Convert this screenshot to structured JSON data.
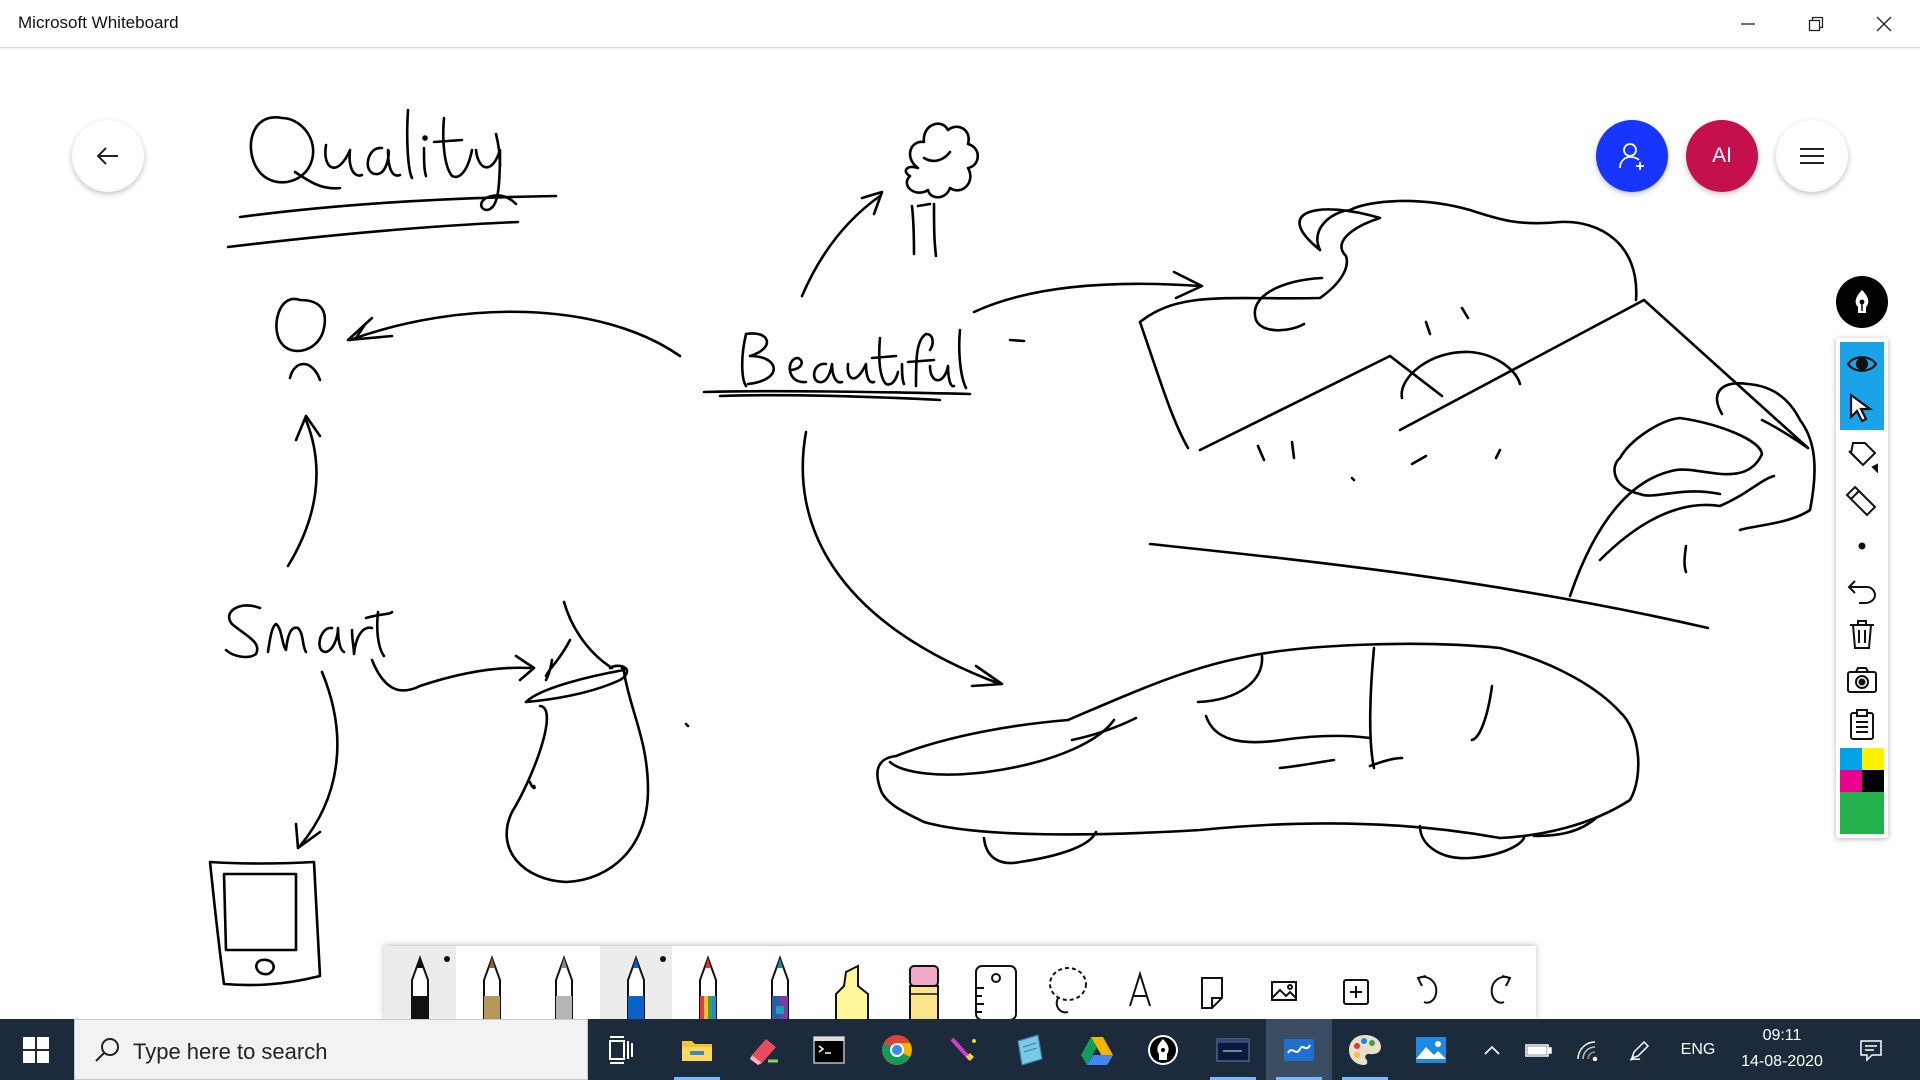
{
  "window": {
    "title": "Microsoft Whiteboard"
  },
  "header": {
    "avatar_initials": "AI"
  },
  "board": {
    "handwritten_words": [
      "Quality",
      "Beautiful",
      "Smart"
    ]
  },
  "right_toolbar": {
    "tools": [
      "eye-icon",
      "select-arrow-icon",
      "lasso-tag-icon",
      "eraser-icon",
      "dot-icon",
      "undo-icon",
      "delete-icon",
      "camera-icon",
      "clipboard-icon"
    ],
    "palette_colors": [
      "#00a2e8",
      "#fff200",
      "#e9008b",
      "#000000",
      "#22b14c"
    ]
  },
  "pen_tray": {
    "tools": [
      "black-pen",
      "gold-pen",
      "silver-pen",
      "blue-pen",
      "rainbow-pen",
      "galaxy-pen",
      "yellow-highlighter",
      "eraser",
      "ruler",
      "lasso",
      "text",
      "sticky-note",
      "image",
      "add",
      "undo",
      "redo"
    ],
    "colors": {
      "black_pen": "#111111",
      "gold_pen": "#b8975a",
      "silver_pen": "#b5b5b5",
      "blue_pen": "#0a64c8",
      "highlighter": "#fff79a",
      "eraser": "#f0a7c8"
    }
  },
  "taskbar": {
    "search_placeholder": "Type here to search",
    "language": "ENG",
    "time": "09:11",
    "date": "14-08-2020"
  },
  "colors": {
    "taskbar_bg": "#1c2b3c",
    "invite_button": "#1636ff",
    "avatar": "#c4104c",
    "selection": "#1aa3e8"
  }
}
